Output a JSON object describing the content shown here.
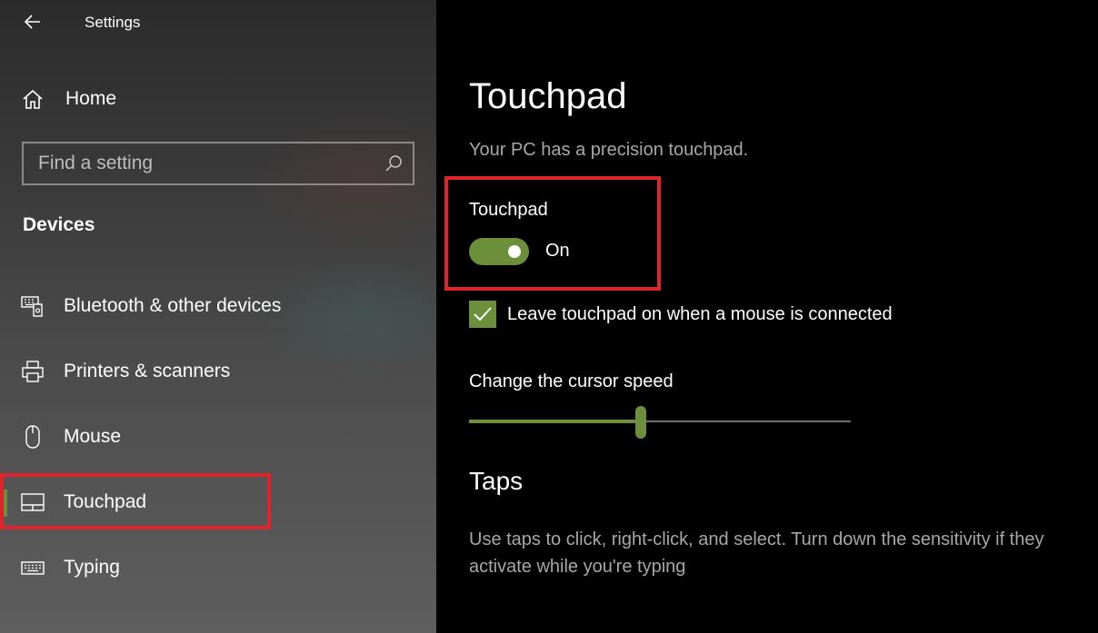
{
  "window": {
    "title": "Settings"
  },
  "sidebar": {
    "home_label": "Home",
    "search_placeholder": "Find a setting",
    "section_title": "Devices",
    "items": [
      {
        "label": "Bluetooth & other devices",
        "icon": "bluetooth-devices-icon"
      },
      {
        "label": "Printers & scanners",
        "icon": "printer-icon"
      },
      {
        "label": "Mouse",
        "icon": "mouse-icon"
      },
      {
        "label": "Touchpad",
        "icon": "touchpad-icon",
        "active": true
      },
      {
        "label": "Typing",
        "icon": "keyboard-icon"
      }
    ]
  },
  "main": {
    "title": "Touchpad",
    "subtitle": "Your PC has a precision touchpad.",
    "touchpad_toggle": {
      "label": "Touchpad",
      "state": "On",
      "on": true
    },
    "leave_on_checkbox": {
      "label": "Leave touchpad on when a mouse is connected",
      "checked": true
    },
    "cursor_speed": {
      "label": "Change the cursor speed",
      "value_fraction": 0.45
    },
    "taps": {
      "heading": "Taps",
      "description": "Use taps to click, right-click, and select. Turn down the sensitivity if they activate while you're typing"
    }
  },
  "colors": {
    "accent": "#6b8f3a",
    "highlight": "#e0242b",
    "secondary_text": "#a7a7a7"
  }
}
